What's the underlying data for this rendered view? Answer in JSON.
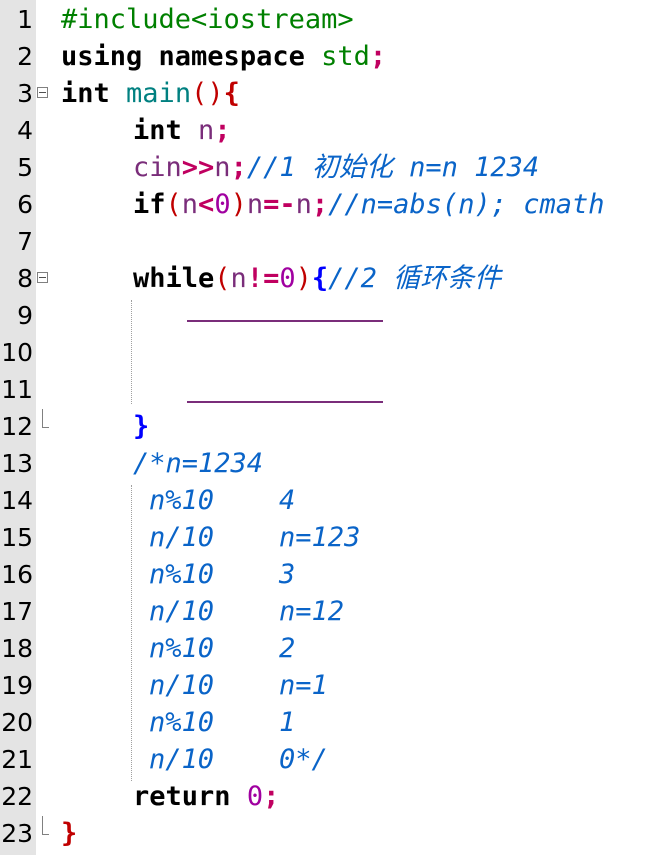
{
  "editor": {
    "lines": [
      {
        "num": "1",
        "t": [
          "#include<iostream>"
        ]
      },
      {
        "num": "2",
        "t": [
          "using",
          " namespace ",
          "std",
          ";"
        ]
      },
      {
        "num": "3",
        "t": [
          "int",
          " ",
          "main",
          "()",
          "{"
        ]
      },
      {
        "num": "4",
        "t": [
          "int",
          " ",
          "n",
          ";"
        ]
      },
      {
        "num": "5",
        "t": [
          "cin",
          ">>",
          "n",
          ";",
          "//1 初始化 n=n 1234"
        ]
      },
      {
        "num": "6",
        "t": [
          "if",
          "(",
          "n",
          "<",
          "0",
          ")",
          "n",
          "=-",
          "n",
          ";",
          "//n=abs(n); cmath"
        ]
      },
      {
        "num": "7",
        "t": []
      },
      {
        "num": "8",
        "t": [
          "while",
          "(",
          "n",
          "!=",
          "0",
          ")",
          "{",
          "//2 循环条件"
        ]
      },
      {
        "num": "9",
        "t": []
      },
      {
        "num": "10",
        "t": []
      },
      {
        "num": "11",
        "t": []
      },
      {
        "num": "12",
        "t": [
          "}"
        ]
      },
      {
        "num": "13",
        "t": [
          "/*n=1234"
        ]
      },
      {
        "num": "14",
        "t": [
          "n%10    4"
        ]
      },
      {
        "num": "15",
        "t": [
          "n/10    n=123"
        ]
      },
      {
        "num": "16",
        "t": [
          "n%10    3"
        ]
      },
      {
        "num": "17",
        "t": [
          "n/10    n=12"
        ]
      },
      {
        "num": "18",
        "t": [
          "n%10    2"
        ]
      },
      {
        "num": "19",
        "t": [
          "n/10    n=1"
        ]
      },
      {
        "num": "20",
        "t": [
          "n%10    1"
        ]
      },
      {
        "num": "21",
        "t": [
          "n/10    0*/"
        ]
      },
      {
        "num": "22",
        "t": [
          "return",
          " ",
          "0",
          ";"
        ]
      },
      {
        "num": "23",
        "t": [
          "}"
        ]
      }
    ]
  },
  "colors": {
    "comment": "#0a64c8",
    "preprocessor": "#008000",
    "function": "#008080",
    "identifier": "#7a2d7a",
    "operator": "#c00060",
    "number": "#a000a0",
    "brace_outer": "#c00000",
    "brace_inner": "#0000ff",
    "gutter": "#e4e4e4"
  },
  "icons": {
    "fold_open": "fold-minus-icon",
    "fold_end": "fold-end-icon"
  }
}
